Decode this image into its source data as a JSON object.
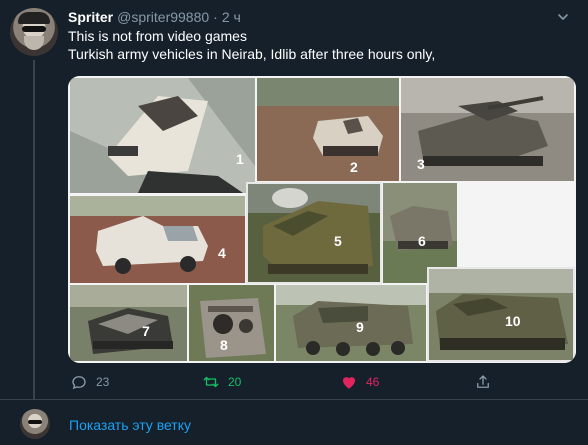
{
  "tweet": {
    "name": "Spriter",
    "handle": "@spriter99880",
    "separator": "·",
    "time": "2 ч",
    "lines": [
      "This is not from video games",
      "Turkish army vehicles in Neirab, Idlib after three hours only,"
    ]
  },
  "media": {
    "photo_labels": [
      "1",
      "2",
      "3",
      "4",
      "5",
      "6",
      "7",
      "8",
      "9",
      "10"
    ]
  },
  "actions": {
    "reply_count": "23",
    "retweet_count": "20",
    "like_count": "46"
  },
  "thread_link": "Показать эту ветку",
  "colors": {
    "background": "#15202b",
    "text_secondary": "#8899a6",
    "link": "#1da1f2",
    "retweet": "#17bf63",
    "like": "#e0245e",
    "border": "#38444d"
  },
  "icons": [
    "chevron-down-icon",
    "reply-icon",
    "retweet-icon",
    "heart-icon",
    "share-icon"
  ]
}
